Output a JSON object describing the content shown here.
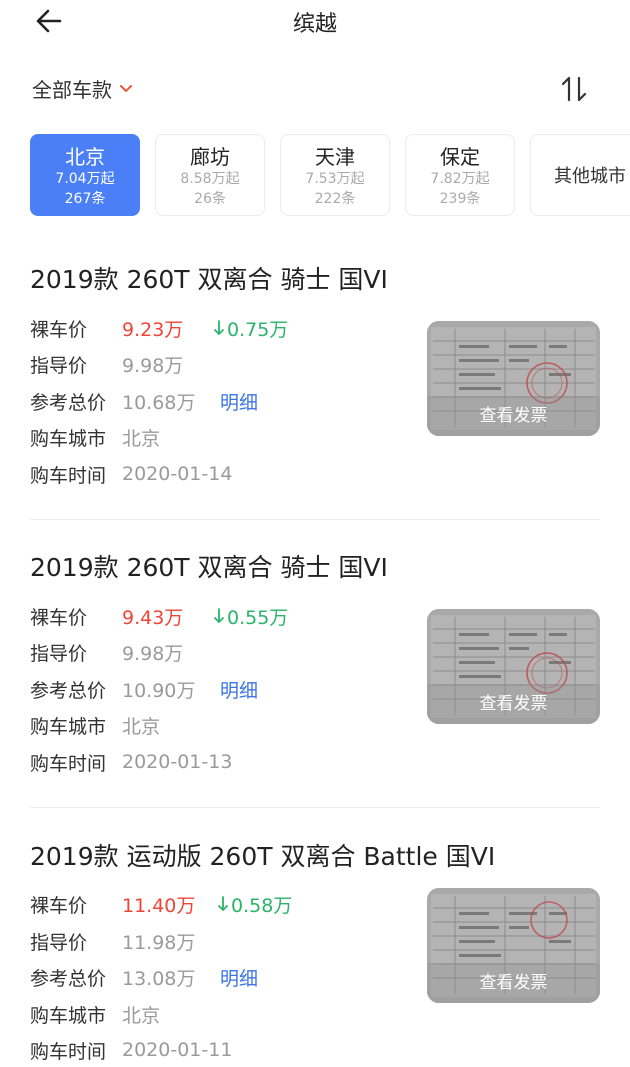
{
  "header": {
    "title": "缤越"
  },
  "filter": {
    "model_label": "全部车款"
  },
  "city_tabs": [
    {
      "name": "北京",
      "price": "7.04万起",
      "count": "267条",
      "active": true
    },
    {
      "name": "廊坊",
      "price": "8.58万起",
      "count": "26条",
      "active": false
    },
    {
      "name": "天津",
      "price": "7.53万起",
      "count": "222条",
      "active": false
    },
    {
      "name": "保定",
      "price": "7.82万起",
      "count": "239条",
      "active": false
    },
    {
      "name": "其他城市",
      "active": false
    }
  ],
  "labels": {
    "bare_price": "裸车价",
    "guide_price": "指导价",
    "total_price": "参考总价",
    "city": "购车城市",
    "time": "购车时间",
    "detail": "明细",
    "invoice": "查看发票"
  },
  "listings": [
    {
      "title": "2019款 260T 双离合 骑士 国VI",
      "bare_price": "9.23万",
      "discount": "0.75万",
      "guide_price": "9.98万",
      "total_price": "10.68万",
      "city": "北京",
      "time": "2020-01-14"
    },
    {
      "title": "2019款 260T 双离合 骑士 国VI",
      "bare_price": "9.43万",
      "discount": "0.55万",
      "guide_price": "9.98万",
      "total_price": "10.90万",
      "city": "北京",
      "time": "2020-01-13"
    },
    {
      "title": "2019款 运动版 260T 双离合 Battle 国VI",
      "bare_price": "11.40万",
      "discount": "0.58万",
      "guide_price": "11.98万",
      "total_price": "13.08万",
      "city": "北京",
      "time": "2020-01-11"
    }
  ],
  "colors": {
    "accent_blue": "#4a7ff7",
    "price_red": "#f04438",
    "discount_green": "#2bb36a",
    "link_blue": "#3c74e6",
    "chevron_orange": "#f0563a"
  },
  "icons": {
    "back": "arrow-left-icon",
    "chevron": "chevron-down-icon",
    "sort": "sort-icon",
    "discount": "arrow-down-icon"
  }
}
